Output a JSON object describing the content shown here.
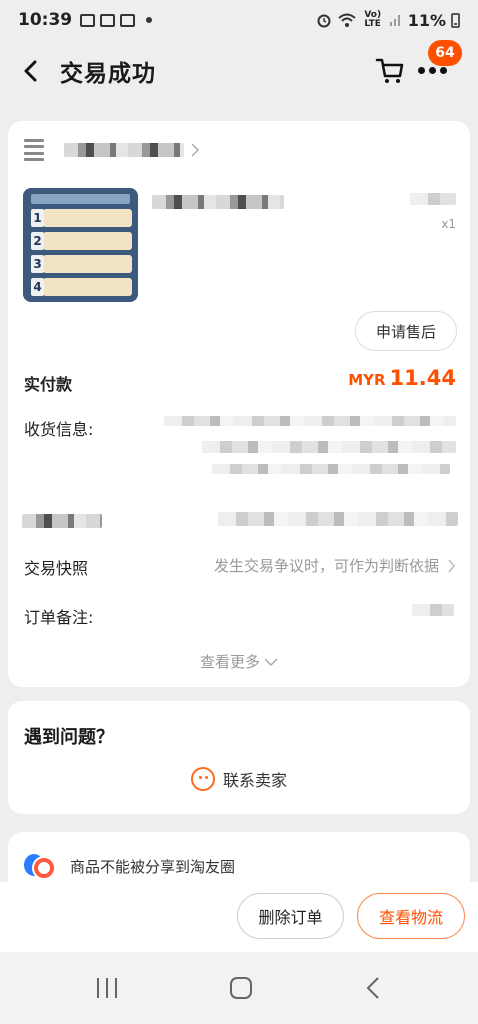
{
  "status_bar": {
    "time": "10:39",
    "battery": "11%",
    "signal_label": "Vo) LTE"
  },
  "header": {
    "title": "交易成功",
    "cart_badge": "64"
  },
  "order": {
    "quantity": "x1",
    "after_sale_label": "申请售后",
    "paid_label": "实付款",
    "paid_currency": "MYR",
    "paid_amount": "11.44",
    "address_label": "收货信息:",
    "snapshot_label": "交易快照",
    "snapshot_hint": "发生交易争议时，可作为判断依据",
    "memo_label": "订单备注:",
    "see_more_label": "查看更多"
  },
  "help": {
    "title": "遇到问题？",
    "contact_label": "联系卖家"
  },
  "share": {
    "notice": "商品不能被分享到淘友圈"
  },
  "actions": {
    "delete_label": "删除订单",
    "logistics_label": "查看物流"
  },
  "colors": {
    "accent": "#ff5000",
    "background": "#eeeeee"
  }
}
